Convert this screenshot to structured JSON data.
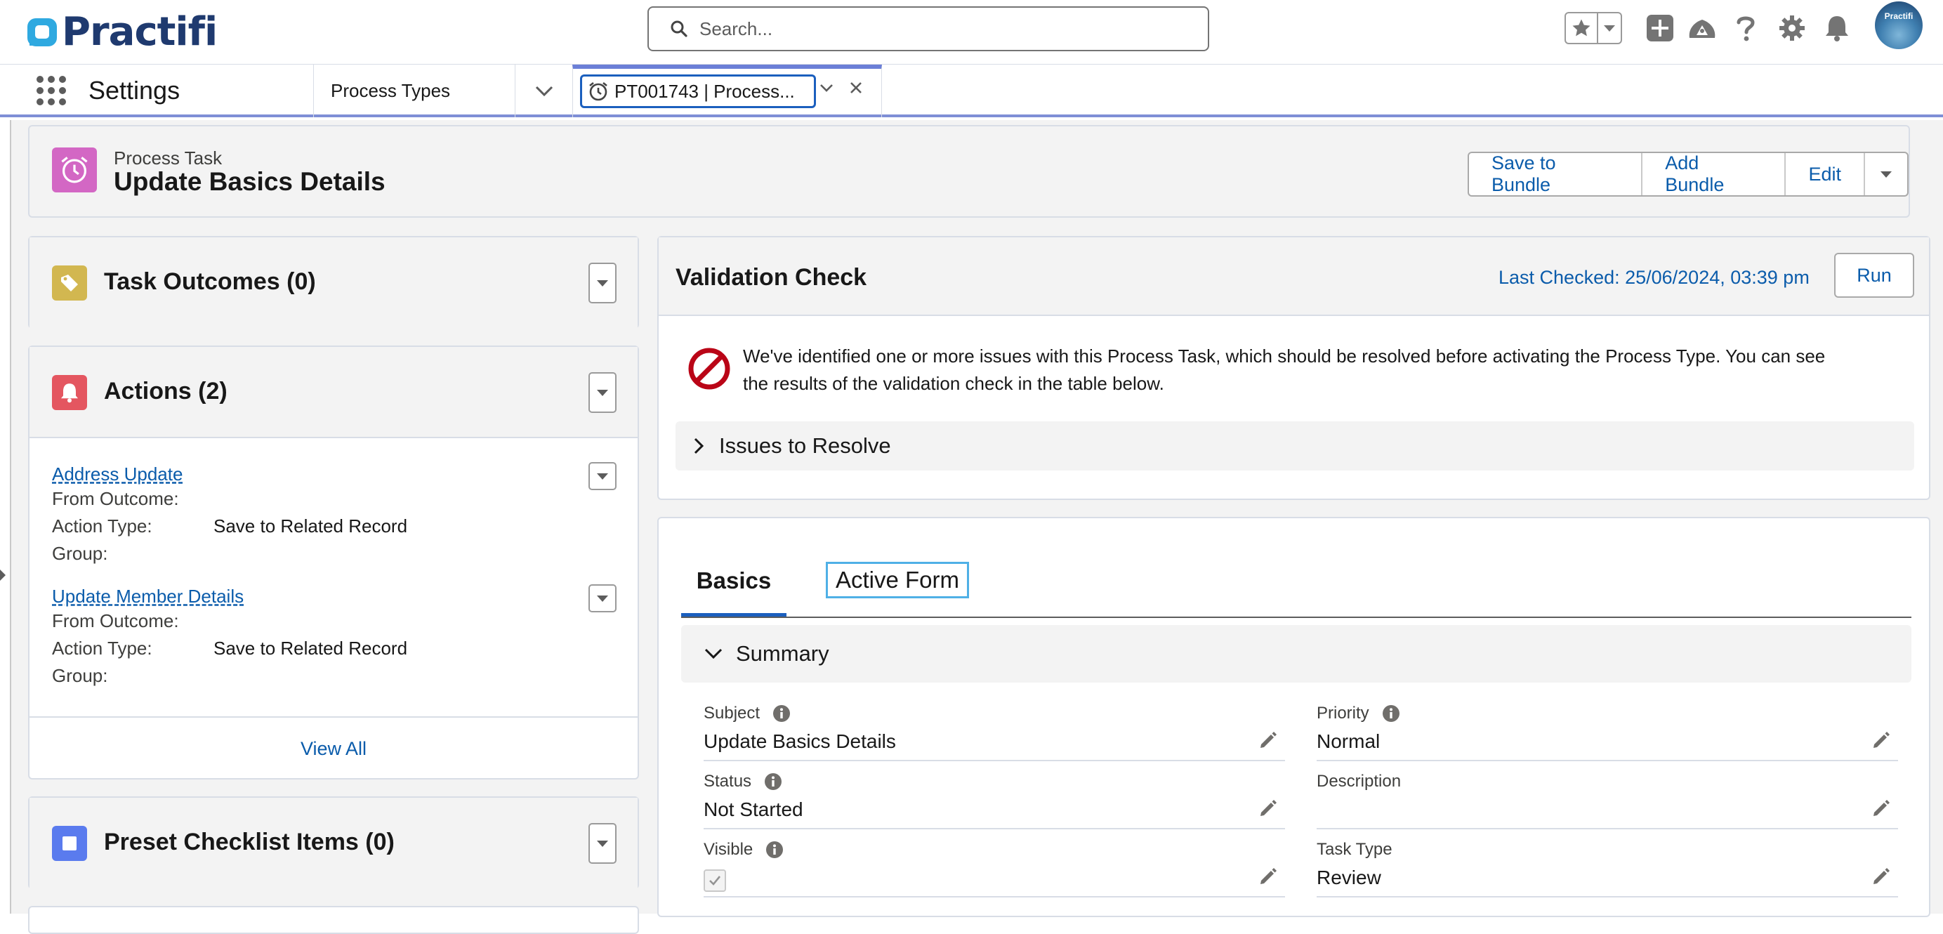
{
  "brand": {
    "name": "Practifi",
    "avatar_text": "Practifi"
  },
  "search": {
    "placeholder": "Search..."
  },
  "nav": {
    "app_name": "Settings",
    "tabs": [
      {
        "label": "Process Types"
      },
      {
        "label": "PT001743 | Process..."
      }
    ]
  },
  "record": {
    "type": "Process Task",
    "title": "Update Basics Details",
    "buttons": {
      "save_to_bundle": "Save to Bundle",
      "add_bundle": "Add Bundle",
      "edit": "Edit"
    }
  },
  "related": {
    "outcomes": {
      "title": "Task Outcomes (0)"
    },
    "actions": {
      "title": "Actions (2)",
      "items": [
        {
          "name": "Address Update",
          "from_outcome_label": "From Outcome:",
          "from_outcome": "",
          "action_type_label": "Action Type:",
          "action_type": "Save to Related Record",
          "group_label": "Group:",
          "group": ""
        },
        {
          "name": "Update Member Details",
          "from_outcome_label": "From Outcome:",
          "from_outcome": "",
          "action_type_label": "Action Type:",
          "action_type": "Save to Related Record",
          "group_label": "Group:",
          "group": ""
        }
      ],
      "view_all": "View All"
    },
    "checklist": {
      "title": "Preset Checklist Items (0)"
    }
  },
  "validation": {
    "title": "Validation Check",
    "last_checked": "Last Checked: 25/06/2024, 03:39 pm",
    "run": "Run",
    "message_line1": "We've identified one or more issues with this Process Task, which should be resolved before activating the Process Type. You can see",
    "message_line2": "the results of the validation check in the table below.",
    "issues": "Issues to Resolve"
  },
  "details": {
    "tabs": {
      "basics": "Basics",
      "active_form": "Active Form"
    },
    "section": "Summary",
    "fields": {
      "subject": {
        "label": "Subject",
        "value": "Update Basics Details"
      },
      "priority": {
        "label": "Priority",
        "value": "Normal"
      },
      "status": {
        "label": "Status",
        "value": "Not Started"
      },
      "description": {
        "label": "Description",
        "value": ""
      },
      "visible": {
        "label": "Visible",
        "checked": true
      },
      "task_type": {
        "label": "Task Type",
        "value": "Review"
      }
    }
  },
  "colors": {
    "brand": "#1f3a6f",
    "link": "#0b5cab",
    "accent": "#1b5fbe",
    "record_icon": "#d367c4",
    "error": "#ba0517"
  },
  "icons": [
    "search-icon",
    "star-icon",
    "plus-icon",
    "trailhead-icon",
    "help-icon",
    "gear-icon",
    "bell-icon",
    "alarm-clock-icon",
    "close-icon",
    "chevron-down-icon",
    "chevron-right-icon",
    "info-icon",
    "pencil-icon",
    "checkbox-icon",
    "prohibited-icon"
  ]
}
